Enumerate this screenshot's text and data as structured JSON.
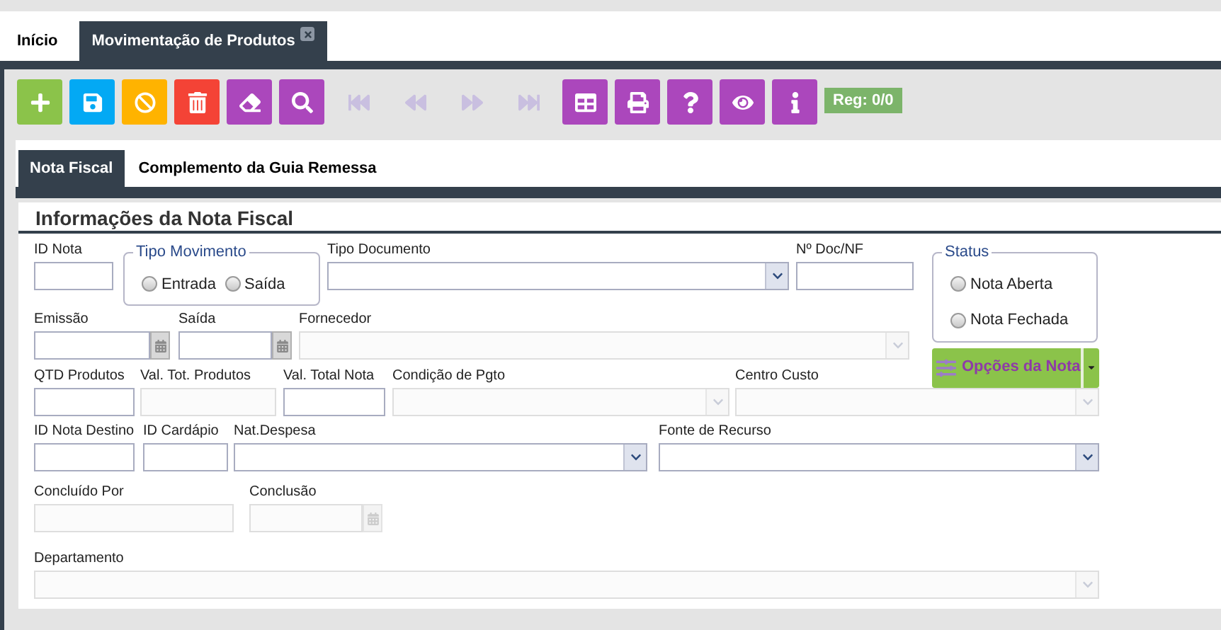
{
  "tabs": [
    {
      "label": "Início",
      "selected": false,
      "closable": false
    },
    {
      "label": "Movimentação de Produtos",
      "selected": true,
      "closable": true
    }
  ],
  "toolbar": [
    {
      "kind": "add",
      "disabled": false
    },
    {
      "kind": "save",
      "disabled": false
    },
    {
      "kind": "cancel",
      "disabled": false
    },
    {
      "kind": "delete",
      "disabled": false
    },
    {
      "kind": "clear",
      "disabled": false
    },
    {
      "kind": "search",
      "disabled": false
    },
    {
      "kind": "first",
      "disabled": true
    },
    {
      "kind": "previous",
      "disabled": true
    },
    {
      "kind": "next",
      "disabled": true
    },
    {
      "kind": "last",
      "disabled": true
    },
    {
      "kind": "grid",
      "disabled": false
    },
    {
      "kind": "print",
      "disabled": false
    },
    {
      "kind": "help",
      "disabled": false
    },
    {
      "kind": "view",
      "disabled": false
    },
    {
      "kind": "info",
      "disabled": false
    }
  ],
  "record_badge": "Reg: 0/0",
  "subtabs": [
    {
      "label": "Nota Fiscal",
      "selected": true
    },
    {
      "label": "Complemento da Guia Remessa",
      "selected": false
    }
  ],
  "form": {
    "title": "Informações da Nota Fiscal",
    "top_rows": [
      [
        {
          "kind": "text",
          "label": "ID Nota",
          "disabled": false
        },
        {
          "kind": "radio_group",
          "legend": "Tipo Movimento",
          "options": [
            {
              "label": "Entrada",
              "selected": false
            },
            {
              "label": "Saída",
              "selected": false
            }
          ]
        },
        {
          "kind": "select",
          "label": "Tipo Documento",
          "disabled": false
        },
        {
          "kind": "text",
          "label": "Nº Doc/NF",
          "disabled": false
        }
      ],
      [
        {
          "kind": "date",
          "label": "Emissão",
          "disabled": false
        },
        {
          "kind": "date",
          "label": "Saída",
          "disabled": false
        },
        {
          "kind": "select",
          "label": "Fornecedor",
          "disabled": true
        }
      ]
    ],
    "status": {
      "legend": "Status",
      "options": [
        {
          "label": "Nota Aberta",
          "selected": false
        },
        {
          "label": "Nota Fechada",
          "selected": false
        }
      ]
    },
    "options_button": "Opções da Nota",
    "rows": [
      [
        {
          "kind": "text",
          "label": "QTD Produtos",
          "disabled": false
        },
        {
          "kind": "text",
          "label": "Val. Tot. Produtos",
          "disabled": true
        },
        {
          "kind": "text",
          "label": "Val. Total Nota",
          "disabled": false
        },
        {
          "kind": "select",
          "label": "Condição de Pgto",
          "disabled": true
        },
        {
          "kind": "select",
          "label": "Centro Custo",
          "disabled": true
        }
      ],
      [
        {
          "kind": "text",
          "label": "ID Nota Destino",
          "disabled": false
        },
        {
          "kind": "text",
          "label": "ID Cardápio",
          "disabled": false
        },
        {
          "kind": "select",
          "label": "Nat.Despesa",
          "disabled": false
        },
        {
          "kind": "select",
          "label": "Fonte de Recurso",
          "disabled": false
        }
      ],
      [
        {
          "kind": "text",
          "label": "Concluído Por",
          "disabled": true
        },
        {
          "kind": "date",
          "label": "Conclusão",
          "disabled": true
        }
      ],
      [
        {
          "kind": "select",
          "label": "Departamento",
          "disabled": true
        }
      ]
    ]
  }
}
